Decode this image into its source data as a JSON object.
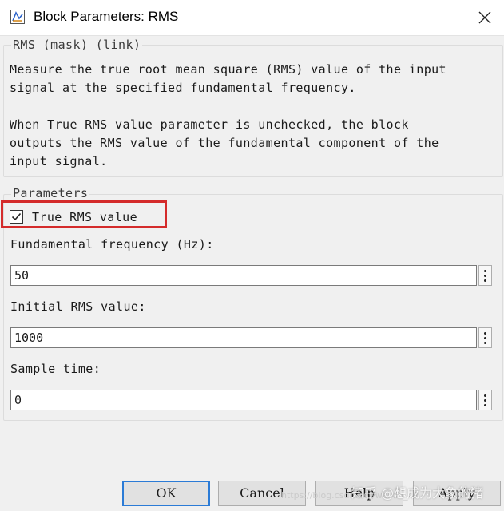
{
  "window": {
    "title": "Block Parameters: RMS",
    "icon": "simulink-block-icon",
    "close_icon": "close-icon"
  },
  "description": {
    "legend": "RMS (mask) (link)",
    "text": "Measure the true root mean square (RMS) value of the input\nsignal at the specified fundamental frequency.\n\nWhen True RMS value parameter is unchecked, the block\noutputs the RMS value of the fundamental component of the\ninput signal."
  },
  "parameters": {
    "legend": "Parameters",
    "true_rms": {
      "label": "True RMS value",
      "checked": true
    },
    "fields": [
      {
        "label": "Fundamental frequency (Hz):",
        "value": "50"
      },
      {
        "label": "Initial RMS value:",
        "value": "1000"
      },
      {
        "label": "Sample time:",
        "value": "0"
      }
    ]
  },
  "buttons": {
    "ok": "OK",
    "cancel": "Cancel",
    "help": "Help",
    "apply": "Apply"
  },
  "watermark": {
    "text": "知乎 @想成为大象的猪",
    "url": "https://blog.csdn.net/weixin_42"
  },
  "colors": {
    "highlight": "#d42b2b",
    "ok_border": "#2b7bd6",
    "background": "#f0f0f0"
  }
}
